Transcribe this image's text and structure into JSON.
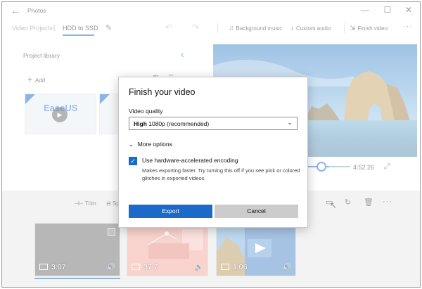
{
  "window": {
    "title": "Photos",
    "back_glyph": "←",
    "minimize_glyph": "—",
    "maximize_glyph": "☐",
    "close_glyph": "✕"
  },
  "toolbar": {
    "breadcrumb_parent": "Video Projects",
    "breadcrumb_sep": "|",
    "project_name": "HDD to SSD",
    "background_music": "Background music",
    "custom_audio": "Custom audio",
    "finish_video": "Finish video",
    "more": "···"
  },
  "library": {
    "title": "Project library",
    "add_label": "Add",
    "thumb1_brand": "EaseUS"
  },
  "preview": {
    "duration": "4:52.26",
    "playhead_fraction": 0.3
  },
  "storyboard": {
    "trim_label": "Trim",
    "split_label": "Sp",
    "more": "···",
    "clips": [
      {
        "duration": "3:07",
        "selected": true
      },
      {
        "duration": "37.7"
      },
      {
        "duration": "1:06"
      }
    ]
  },
  "dialog": {
    "title": "Finish your video",
    "quality_label": "Video quality",
    "quality_value_bold": "High",
    "quality_value_rest": " 1080p (recommended)",
    "more_options": "More options",
    "hw_accel_label": "Use hardware-accelerated encoding",
    "hw_accel_checked": true,
    "hw_accel_description": "Makes exporting faster. Try turning this off if you see pink or colored glitches in exported videos.",
    "export_label": "Export",
    "cancel_label": "Cancel"
  },
  "colors": {
    "accent": "#1b6ac9",
    "cancel_bg": "#cccccc"
  }
}
